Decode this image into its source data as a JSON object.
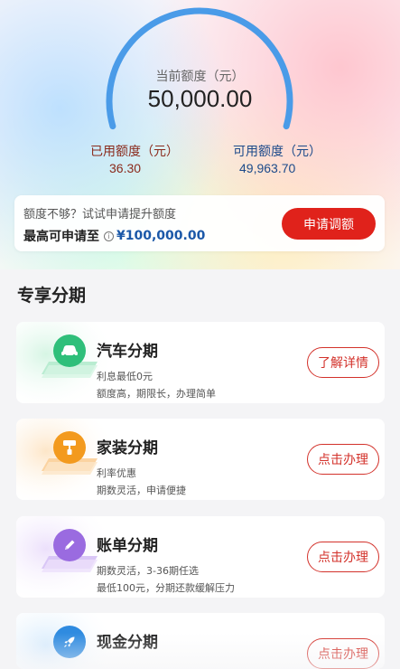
{
  "credit": {
    "current_limit_label": "当前额度（元）",
    "current_limit_value": "50,000.00",
    "used_label": "已用额度（元）",
    "used_value": "36.30",
    "available_label": "可用额度（元）",
    "available_value": "49,963.70",
    "used_fraction": 0.0007
  },
  "promo": {
    "hint": "额度不够？试试申请提升额度",
    "max_label": "最高可申请至",
    "max_amount": "¥100,000.00",
    "apply_button": "申请调额"
  },
  "section": {
    "title": "专享分期"
  },
  "products": [
    {
      "title": "汽车分期",
      "line1": "利息最低0元",
      "line2": "额度高，期限长，办理简单",
      "button": "了解详情",
      "icon": "car-icon",
      "color": "#2fbf7a"
    },
    {
      "title": "家装分期",
      "line1": "利率优惠",
      "line2": "期数灵活，申请便捷",
      "button": "点击办理",
      "icon": "paint-roller-icon",
      "color": "#f39a1e"
    },
    {
      "title": "账单分期",
      "line1": "期数灵活，3-36期任选",
      "line2": "最低100元，分期还款缓解压力",
      "button": "点击办理",
      "icon": "pencil-icon",
      "color": "#9a6be0"
    },
    {
      "title": "现金分期",
      "line1": "",
      "line2": "",
      "button": "点击办理",
      "icon": "rocket-icon",
      "color": "#2f8be0"
    }
  ],
  "colors": {
    "accent_red": "#e0221b",
    "arc_blue": "#4a9be8",
    "used_text": "#8a2a1c",
    "available_text": "#1c4a8a"
  }
}
